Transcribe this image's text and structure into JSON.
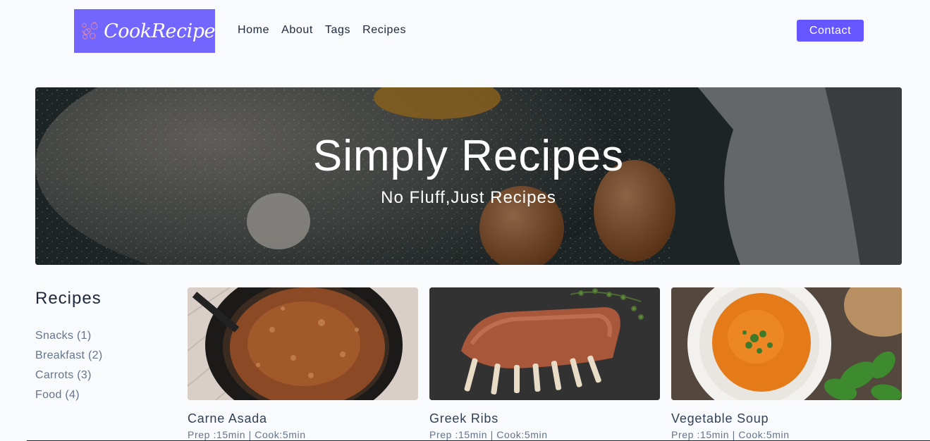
{
  "logo": {
    "text": "CookRecipe",
    "bg_color": "#7366ff"
  },
  "nav": {
    "links": [
      "Home",
      "About",
      "Tags",
      "Recipes"
    ],
    "contact_label": "Contact",
    "accent": "#6556ff"
  },
  "hero": {
    "title": "Simply Recipes",
    "subtitle": "No Fluff,Just Recipes"
  },
  "sidebar": {
    "title": "Recipes",
    "tags": [
      "Snacks (1)",
      "Breakfast (2)",
      "Carrots (3)",
      "Food (4)"
    ]
  },
  "recipes": [
    {
      "title": "Carne Asada",
      "meta": "Prep :15min | Cook:5min",
      "image": "carne-asada-photo"
    },
    {
      "title": "Greek Ribs",
      "meta": "Prep :15min | Cook:5min",
      "image": "greek-ribs-photo"
    },
    {
      "title": "Vegetable Soup",
      "meta": "Prep :15min | Cook:5min",
      "image": "vegetable-soup-photo"
    }
  ]
}
